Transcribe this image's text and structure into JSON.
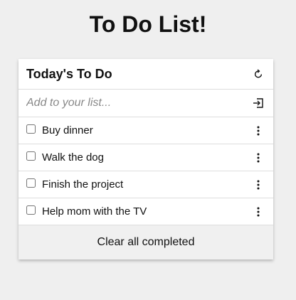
{
  "page": {
    "title": "To Do List!"
  },
  "card": {
    "title": "Today's To Do",
    "refresh_icon": "refresh-icon",
    "add": {
      "placeholder": "Add to your list...",
      "value": "",
      "submit_icon": "enter-icon"
    },
    "items": [
      {
        "label": "Buy dinner",
        "checked": false,
        "menu_icon": "more-vertical-icon"
      },
      {
        "label": "Walk the dog",
        "checked": false,
        "menu_icon": "more-vertical-icon"
      },
      {
        "label": "Finish the project",
        "checked": false,
        "menu_icon": "more-vertical-icon"
      },
      {
        "label": "Help mom with the TV",
        "checked": false,
        "menu_icon": "more-vertical-icon"
      }
    ],
    "footer_label": "Clear all completed"
  }
}
